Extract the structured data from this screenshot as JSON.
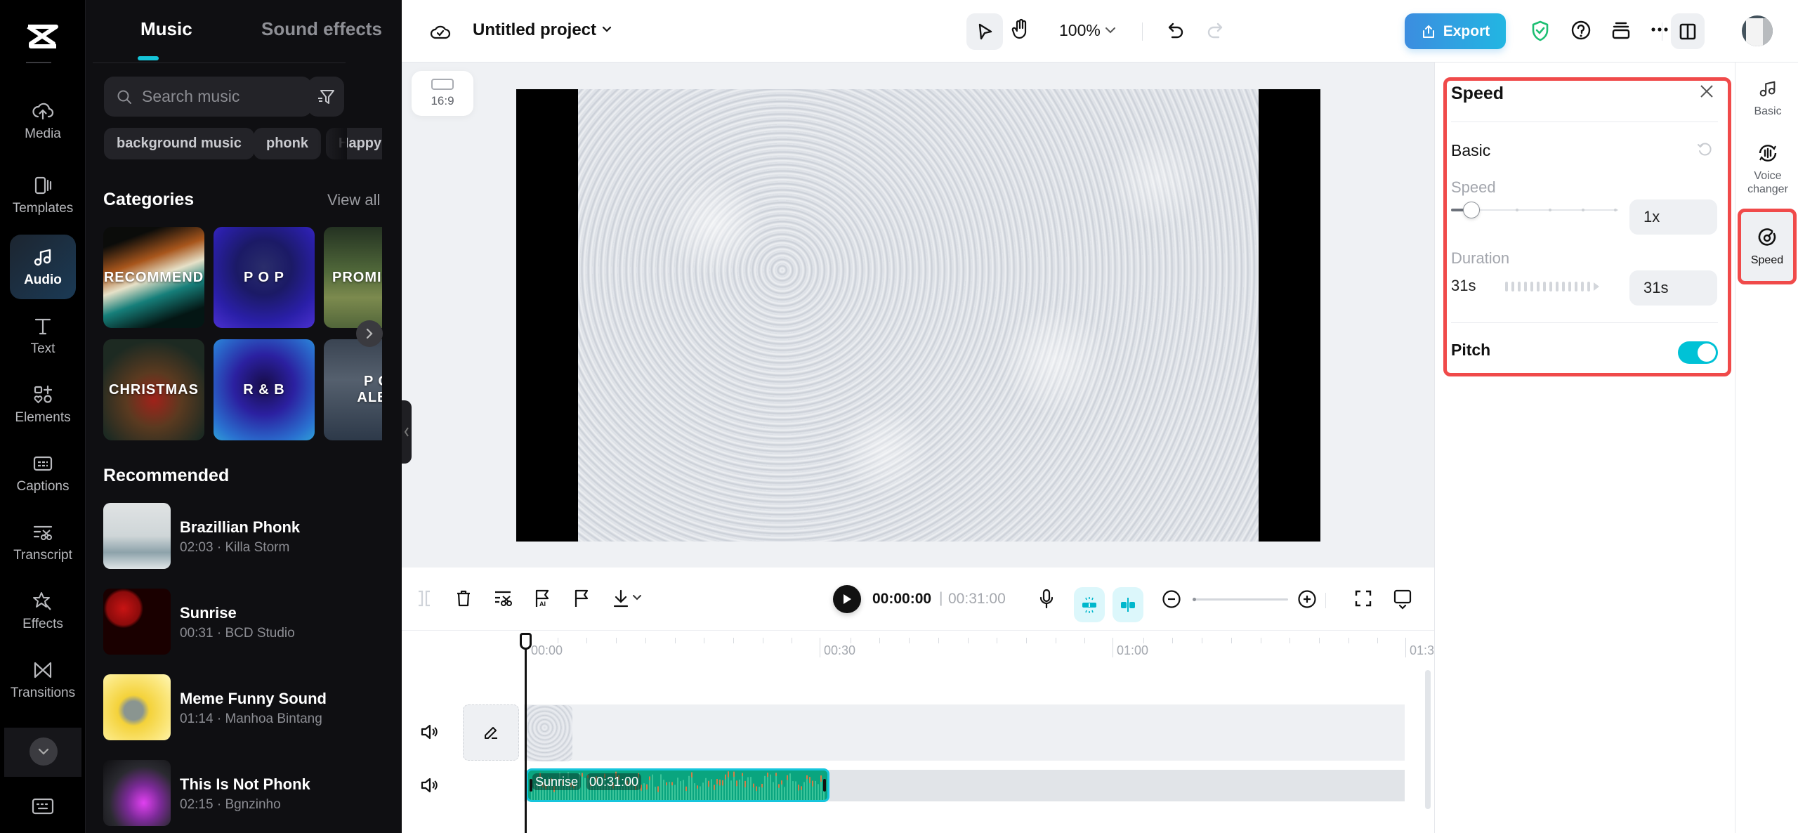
{
  "app": {
    "name": "CapCut"
  },
  "left_nav": {
    "items": [
      {
        "label": "Media",
        "icon": "cloud-upload-icon"
      },
      {
        "label": "Templates",
        "icon": "templates-icon"
      },
      {
        "label": "Audio",
        "icon": "music-note-icon",
        "active": true
      },
      {
        "label": "Text",
        "icon": "text-icon"
      },
      {
        "label": "Elements",
        "icon": "elements-icon"
      },
      {
        "label": "Captions",
        "icon": "captions-icon"
      },
      {
        "label": "Transcript",
        "icon": "transcript-icon"
      },
      {
        "label": "Effects",
        "icon": "effects-star-icon"
      },
      {
        "label": "Transitions",
        "icon": "transitions-icon"
      }
    ],
    "more_icon": "chevron-down-icon",
    "keyboard_icon": "keyboard-shortcuts-icon"
  },
  "audio_panel": {
    "tabs": [
      {
        "label": "Music",
        "active": true
      },
      {
        "label": "Sound effects",
        "active": false
      }
    ],
    "search": {
      "placeholder": "Search music",
      "value": ""
    },
    "chips": [
      "background music",
      "phonk",
      "Happy"
    ],
    "categories_title": "Categories",
    "view_all": "View all",
    "categories": [
      {
        "label": "RECOMMEND"
      },
      {
        "label": "P O P"
      },
      {
        "label": "PROMISE"
      },
      {
        "label": "CHRISTMAS"
      },
      {
        "label": "R & B"
      },
      {
        "label": "P O P ALBUM"
      }
    ],
    "recommended_title": "Recommended",
    "tracks": [
      {
        "title": "Brazillian Phonk",
        "duration": "02:03",
        "artist": "Killa Storm"
      },
      {
        "title": "Sunrise",
        "duration": "00:31",
        "artist": "BCD Studio"
      },
      {
        "title": "Meme Funny Sound",
        "duration": "01:14",
        "artist": "Manhoa Bintang"
      },
      {
        "title": "This Is Not Phonk",
        "duration": "02:15",
        "artist": "Bgnzinho"
      }
    ],
    "meta_separator": " · "
  },
  "topbar": {
    "project_title": "Untitled project",
    "zoom": "100%",
    "export_label": "Export",
    "accent": "#2aa8e2"
  },
  "preview": {
    "aspect_ratio": "16:9"
  },
  "speed_panel": {
    "title": "Speed",
    "section": "Basic",
    "speed_label": "Speed",
    "speed_value": "1x",
    "speed_slider_fraction": 0.12,
    "duration_label": "Duration",
    "duration_original": "31s",
    "duration_value": "31s",
    "pitch_label": "Pitch",
    "pitch_enabled": true,
    "highlight_color": "#f04a4a",
    "toggle_color": "#00c2d6"
  },
  "right_rail": {
    "items": [
      {
        "label": "Basic",
        "icon": "music-note-icon"
      },
      {
        "label": "Voice changer",
        "icon": "voice-changer-icon"
      },
      {
        "label": "Speed",
        "icon": "speedometer-icon",
        "active": true
      }
    ]
  },
  "timeline": {
    "current_time": "00:00:00",
    "separator": "|",
    "total_time": "00:31:00",
    "ruler_labels": [
      "00:00",
      "00:30",
      "01:00",
      "01:3"
    ],
    "audio_clip": {
      "name": "Sunrise",
      "duration": "00:31:00",
      "color": "#0aa57f"
    }
  }
}
